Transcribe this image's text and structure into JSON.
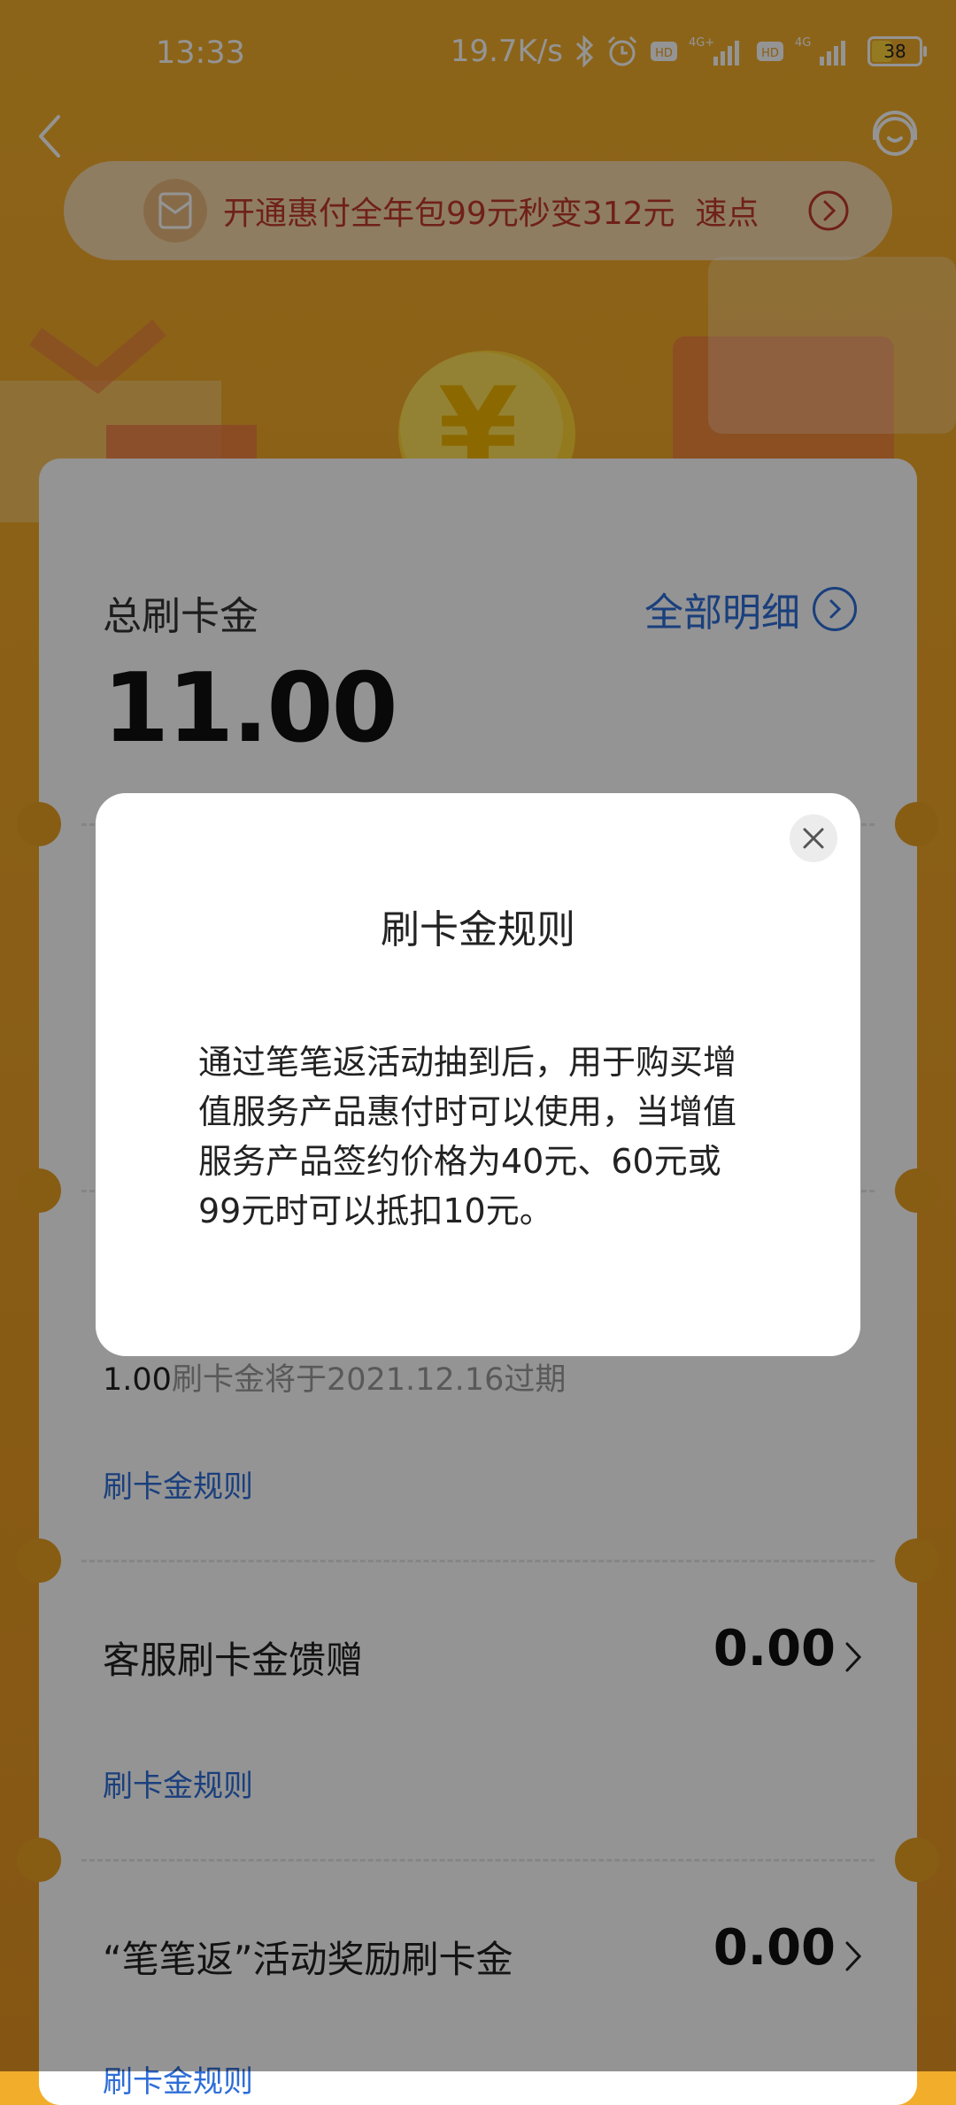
{
  "status_bar": {
    "time": "13:33",
    "speed": "19.7K/s",
    "battery": "38"
  },
  "banner": {
    "text": "开通惠付全年包99元秒变312元",
    "link": "速点"
  },
  "summary": {
    "label": "总刷卡金",
    "amount": "11.00",
    "detail_link": "全部明细"
  },
  "expiry": {
    "amount": "1.00",
    "text": "刷卡金将于2021.12.16过期"
  },
  "sections": [
    {
      "rules_link": "刷卡金规则"
    },
    {
      "title": "客服刷卡金馈赠",
      "value": "0.00",
      "rules_link": "刷卡金规则"
    },
    {
      "title": "“笔笔返”活动奖励刷卡金",
      "value": "0.00",
      "rules_link": "刷卡金规则"
    }
  ],
  "modal": {
    "title": "刷卡金规则",
    "body": "通过笔笔返活动抽到后，用于购买增值服务产品惠付时可以使用，当增值服务产品签约价格为40元、60元或99元时可以抵扣10元。"
  },
  "colors": {
    "background": "#eea326",
    "accent_blue": "#2d6dd8",
    "banner_red": "#c0392b"
  }
}
